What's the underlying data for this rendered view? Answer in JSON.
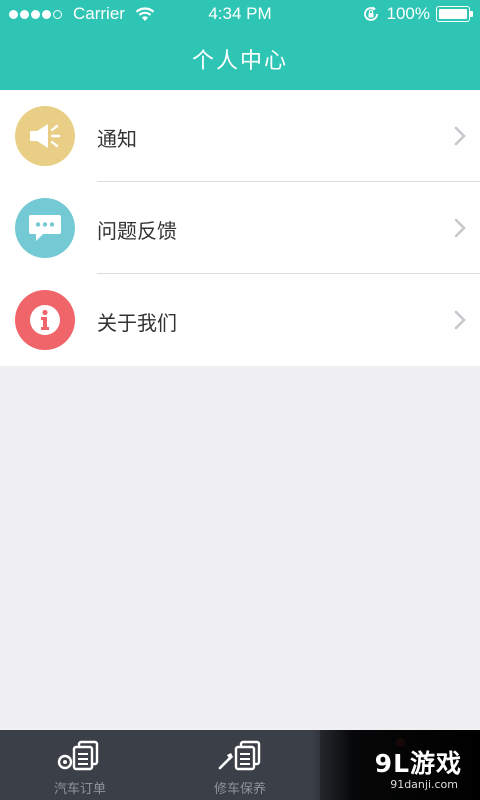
{
  "status_bar": {
    "carrier": "Carrier",
    "time": "4:34 PM",
    "battery_percent": "100%",
    "signal_bars_filled": 4,
    "signal_bars_total": 5
  },
  "nav": {
    "title": "个人中心"
  },
  "menu": {
    "items": [
      {
        "label": "通知",
        "icon": "speaker-icon",
        "color": "#e9cf85"
      },
      {
        "label": "问题反馈",
        "icon": "chat-bubble-icon",
        "color": "#74cad4"
      },
      {
        "label": "关于我们",
        "icon": "info-icon",
        "color": "#f0656a"
      }
    ]
  },
  "tabbar": {
    "tabs": [
      {
        "label": "汽车订单",
        "icon": "car-order-icon",
        "active": false
      },
      {
        "label": "修车保养",
        "icon": "repair-maintenance-icon",
        "active": false
      },
      {
        "label": "",
        "icon": "profile-icon",
        "active": true,
        "has_badge": true
      }
    ]
  },
  "watermark": {
    "logo": "9L游戏",
    "url": "91danji.com"
  },
  "colors": {
    "accent": "#2ec5b4",
    "background": "#efeff4",
    "tabbar": "#3b3f48",
    "badge": "#f3545a"
  }
}
